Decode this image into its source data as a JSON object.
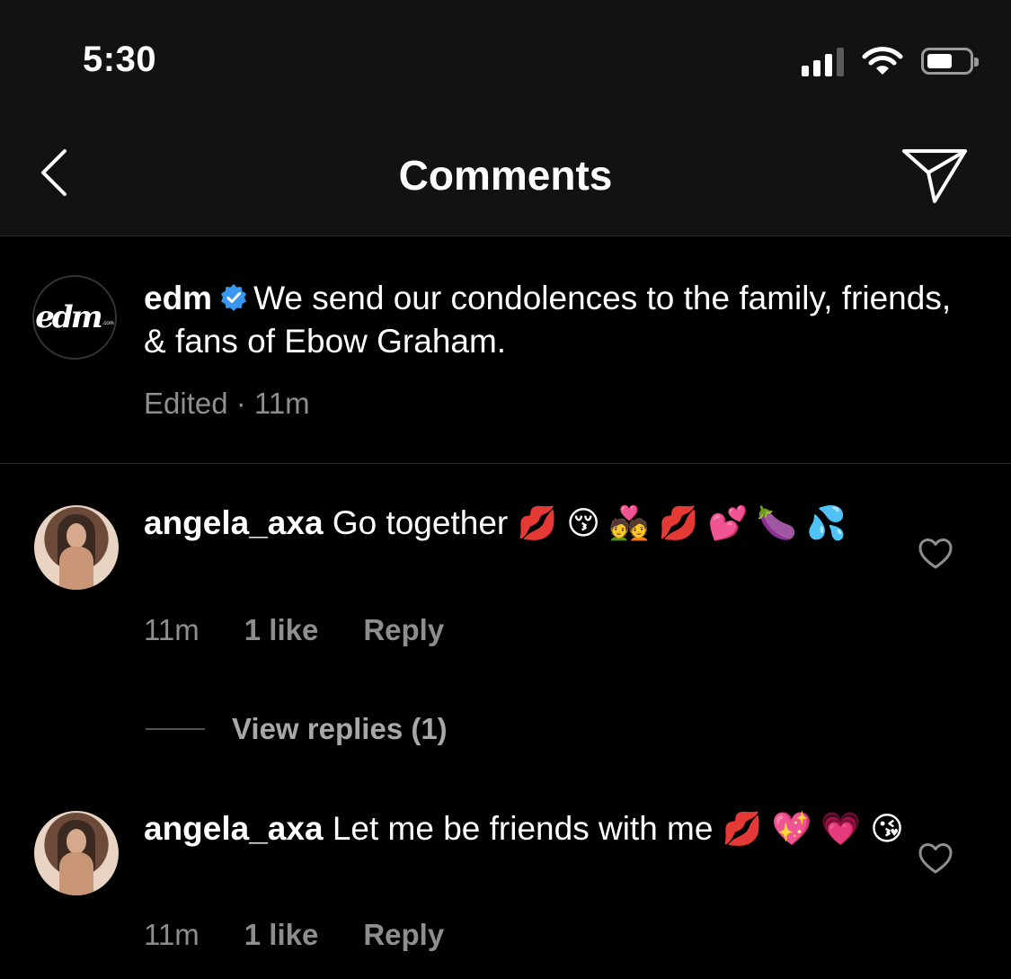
{
  "status_bar": {
    "time": "5:30"
  },
  "nav": {
    "title": "Comments"
  },
  "caption": {
    "username": "edm",
    "avatar_logo": "edm",
    "avatar_logo_suffix": ".com",
    "text": "We send our condolences to the family, friends, & fans of Ebow Graham.",
    "edited": "Edited",
    "separator": "·",
    "time": "11m"
  },
  "comments": [
    {
      "username": "angela_axa",
      "text": "Go together",
      "emojis": "💋 😚 💑 💋 💕 🍆 💦",
      "time": "11m",
      "likes": "1 like",
      "reply_label": "Reply",
      "view_replies": "View replies (1)"
    },
    {
      "username": "angela_axa",
      "text": "Let me be friends with me",
      "emojis": "💋 💖 💗 😘",
      "time": "11m",
      "likes": "1 like",
      "reply_label": "Reply"
    }
  ],
  "icons": {
    "back": "chevron-left-icon",
    "send": "paper-plane-icon",
    "verified": "verified-badge-icon",
    "like": "heart-outline-icon"
  },
  "colors": {
    "background": "#000000",
    "header": "#121212",
    "meta_text": "#8e8e8e",
    "verified": "#3897f0"
  }
}
